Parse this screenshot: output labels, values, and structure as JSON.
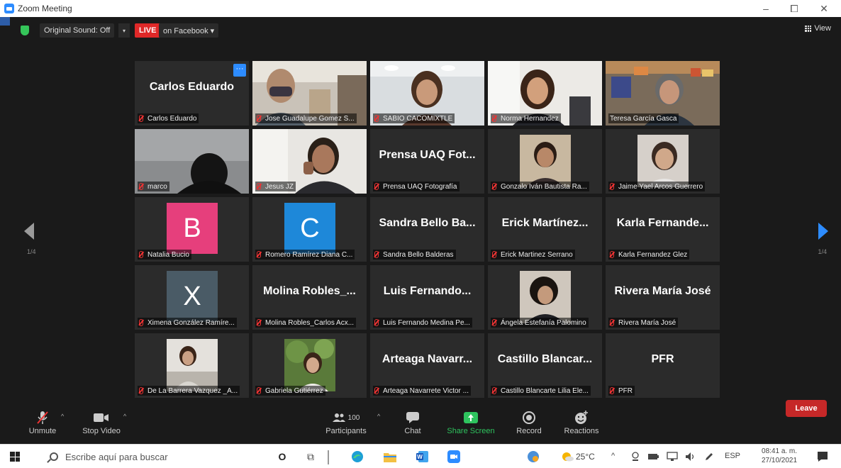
{
  "window": {
    "title": "Zoom Meeting",
    "min": "–",
    "max": "⧠",
    "close": "✕"
  },
  "topbar": {
    "original_sound": "Original Sound: Off",
    "live": "LIVE",
    "on_facebook": "on Facebook ▾",
    "view": "View",
    "caret": "▾"
  },
  "pagination": {
    "left": "1/4",
    "right": "1/4"
  },
  "more_btn": "···",
  "tiles": [
    {
      "big": "Carlos Eduardo",
      "label": "Carlos Eduardo"
    },
    {
      "label": "Jose Guadalupe Gomez S..."
    },
    {
      "label": "SABIO CACOMIXTLE"
    },
    {
      "label": "Norma Hernandez"
    },
    {
      "label": "Teresa García Gasca"
    },
    {
      "label": "marco"
    },
    {
      "label": "Jesus JZ"
    },
    {
      "big": "Prensa UAQ Fot...",
      "label": "Prensa UAQ Fotografía"
    },
    {
      "label": "Gonzalo Iván Bautista Ra..."
    },
    {
      "label": "Jaime Yael Arcos Guerrero"
    },
    {
      "avatar": "B",
      "label": "Natalia Bucio"
    },
    {
      "avatar": "C",
      "label": "Romero Ramírez Diana C..."
    },
    {
      "big": "Sandra Bello Ba...",
      "label": "Sandra Bello Balderas"
    },
    {
      "big": "Erick Martínez...",
      "label": "Erick Martinez Serrano"
    },
    {
      "big": "Karla Fernande...",
      "label": "Karla Fernandez Glez"
    },
    {
      "avatar": "X",
      "label": "Ximena González Ramíre..."
    },
    {
      "big": "Molina Robles_...",
      "label": "Molina Robles_Carlos Acx..."
    },
    {
      "big": "Luis Fernando...",
      "label": "Luis Fernando Medina Pe..."
    },
    {
      "label": "Ángela Estefanía Palomino"
    },
    {
      "big": "Rivera María José",
      "label": "Rivera María José"
    },
    {
      "label": "De La Barrera Vazquez _A..."
    },
    {
      "label": "Gabriela Gutiérrez"
    },
    {
      "big": "Arteaga Navarr...",
      "label": "Arteaga Navarrete Victor ..."
    },
    {
      "big": "Castillo Blancar...",
      "label": "Castillo Blancarte Lilia Ele..."
    },
    {
      "big": "PFR",
      "label": "PFR"
    }
  ],
  "toolbar": {
    "unmute": "Unmute",
    "stop_video": "Stop Video",
    "participants": "Participants",
    "participants_count": "100",
    "chat": "Chat",
    "share_screen": "Share Screen",
    "record": "Record",
    "reactions": "Reactions",
    "leave": "Leave",
    "caret": "^"
  },
  "taskbar": {
    "search_placeholder": "Escribe aquí para buscar",
    "temperature": "25°C",
    "language": "ESP",
    "time": "08:41 a. m.",
    "date": "27/10/2021",
    "cortana": "O",
    "task_view": "⧉",
    "tray_up": "^"
  },
  "colors": {
    "avatar_b": "#e63f7c",
    "avatar_c": "#1e88d9",
    "avatar_x": "#4a5b66",
    "share_green": "#2ec35e",
    "live_red": "#e02828",
    "active_outline": "#d7e94a"
  }
}
